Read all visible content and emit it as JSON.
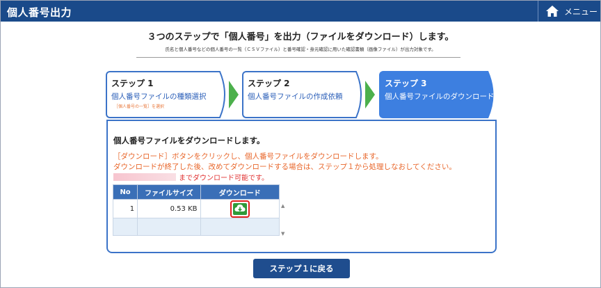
{
  "header": {
    "title": "個人番号出力",
    "menu_label": "メニュー"
  },
  "intro": {
    "title": "３つのステップで「個人番号」を出力（ファイルをダウンロード）します。",
    "subtitle": "氏名と個人番号などの個人番号の一覧（ＣＳＶファイル）と番号確認・身元確認に用いた確認書類（画像ファイル）が出力対象です。"
  },
  "steps": [
    {
      "title": "ステップ 1",
      "desc": "個人番号ファイルの種類選択",
      "note": "［個人番号の一覧］を選択"
    },
    {
      "title": "ステップ 2",
      "desc": "個人番号ファイルの作成依頼"
    },
    {
      "title": "ステップ 3",
      "desc": "個人番号ファイルのダウンロード"
    }
  ],
  "panel": {
    "title": "個人番号ファイルをダウンロードします。",
    "msg1": "［ダウンロード］ボタンをクリックし、個人番号ファイルをダウンロードします。",
    "msg2": "ダウンロードが終了した後、改めてダウンロードする場合は、ステップ１から処理しなおしてください。",
    "deadline_suffix": "までダウンロード可能です。"
  },
  "table": {
    "headers": [
      "No",
      "ファイルサイズ",
      "ダウンロード"
    ],
    "rows": [
      {
        "no": "1",
        "size": "0.53 KB"
      }
    ]
  },
  "buttons": {
    "back": "ステップ１に戻る"
  },
  "icons": {
    "menu": "home-icon",
    "download": "cloud-download-icon",
    "scroll_up": "triangle-up-icon",
    "scroll_down": "triangle-down-icon"
  },
  "colors": {
    "header_bg": "#1a4a8a",
    "step_border": "#3b73c8",
    "active_step": "#3d7fe0",
    "arrow": "#4cb04c",
    "message": "#e8662a",
    "download_green": "#2f9a3a",
    "highlight": "#e02020"
  }
}
